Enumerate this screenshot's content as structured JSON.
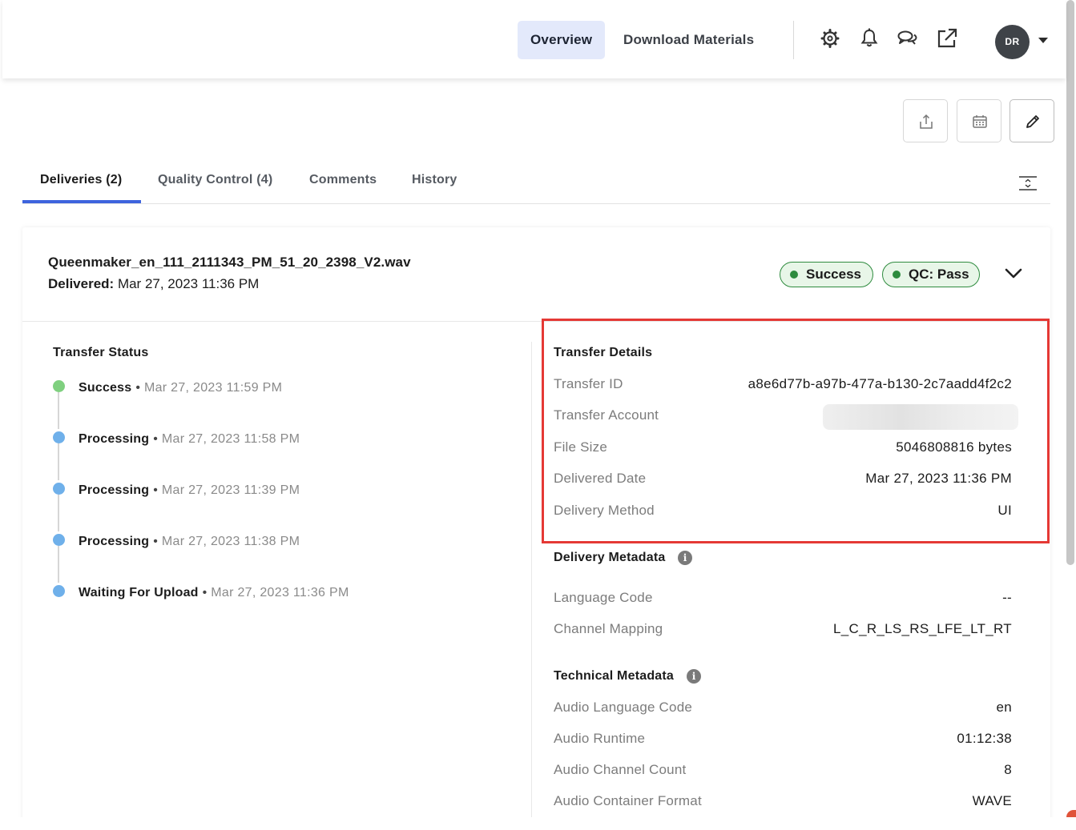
{
  "nav": {
    "tabs": [
      {
        "label": "Overview",
        "active": true
      },
      {
        "label": "Download Materials",
        "active": false
      }
    ],
    "icons": [
      "gear-icon",
      "bell-icon",
      "chat-icon",
      "external-link-icon"
    ],
    "user_initials": "DR"
  },
  "actions": [
    "upload-icon",
    "calendar-icon",
    "edit-icon"
  ],
  "tabs": [
    {
      "label": "Deliveries (2)",
      "active": true
    },
    {
      "label": "Quality Control (4)",
      "active": false
    },
    {
      "label": "Comments",
      "active": false
    },
    {
      "label": "History",
      "active": false
    }
  ],
  "delivery": {
    "file_name": "Queenmaker_en_111_2111343_PM_51_20_2398_V2.wav",
    "delivered_label": "Delivered:",
    "delivered_value": "Mar 27, 2023 11:36 PM",
    "badges": [
      "Success",
      "QC: Pass"
    ],
    "badge_color": "#2e8b3e"
  },
  "transfer_status": {
    "title": "Transfer Status",
    "items": [
      {
        "label": "Success",
        "time": "Mar 27, 2023 11:59 PM",
        "color": "#7fd07f"
      },
      {
        "label": "Processing",
        "time": "Mar 27, 2023 11:58 PM",
        "color": "#6fb0ea"
      },
      {
        "label": "Processing",
        "time": "Mar 27, 2023 11:39 PM",
        "color": "#6fb0ea"
      },
      {
        "label": "Processing",
        "time": "Mar 27, 2023 11:38 PM",
        "color": "#6fb0ea"
      },
      {
        "label": "Waiting For Upload",
        "time": "Mar 27, 2023 11:36 PM",
        "color": "#6fb0ea"
      }
    ]
  },
  "transfer_details": {
    "title": "Transfer Details",
    "rows": [
      {
        "label": "Transfer ID",
        "value": "a8e6d77b-a97b-477a-b130-2c7aadd4f2c2"
      },
      {
        "label": "Transfer Account",
        "value": ""
      },
      {
        "label": "File Size",
        "value": "5046808816 bytes"
      },
      {
        "label": "Delivered Date",
        "value": "Mar 27, 2023 11:36 PM"
      },
      {
        "label": "Delivery Method",
        "value": "UI"
      }
    ]
  },
  "delivery_metadata": {
    "title": "Delivery Metadata",
    "rows": [
      {
        "label": "Language Code",
        "value": "--"
      },
      {
        "label": "Channel Mapping",
        "value": "L_C_R_LS_RS_LFE_LT_RT"
      }
    ]
  },
  "technical_metadata": {
    "title": "Technical Metadata",
    "rows": [
      {
        "label": "Audio Language Code",
        "value": "en"
      },
      {
        "label": "Audio Runtime",
        "value": "01:12:38"
      },
      {
        "label": "Audio Channel Count",
        "value": "8"
      },
      {
        "label": "Audio Container Format",
        "value": "WAVE"
      }
    ]
  },
  "colors": {
    "accent": "#3d63dd",
    "highlight": "#e53935",
    "active_nav_bg": "#e3e9fb"
  }
}
